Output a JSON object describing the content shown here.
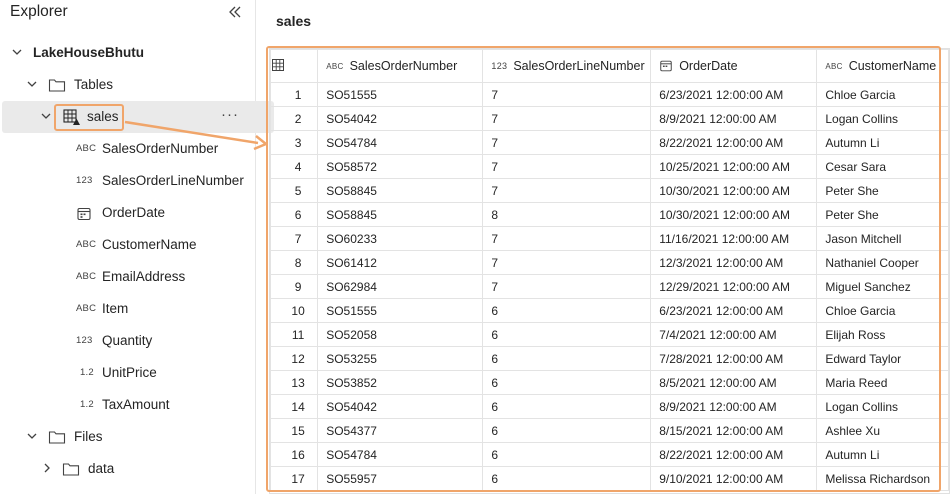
{
  "explorer": {
    "title": "Explorer",
    "lakehouse": "LakeHouseBhutu",
    "tables_folder": "Tables",
    "table_name": "sales",
    "more_label": "···",
    "columns": [
      {
        "type": "ABC",
        "name": "SalesOrderNumber"
      },
      {
        "type": "123",
        "name": "SalesOrderLineNumber"
      },
      {
        "type": "calendar",
        "name": "OrderDate"
      },
      {
        "type": "ABC",
        "name": "CustomerName"
      },
      {
        "type": "ABC",
        "name": "EmailAddress"
      },
      {
        "type": "ABC",
        "name": "Item"
      },
      {
        "type": "123",
        "name": "Quantity"
      },
      {
        "type": "1.2",
        "name": "UnitPrice"
      },
      {
        "type": "1.2",
        "name": "TaxAmount"
      }
    ],
    "files_folder": "Files",
    "data_folder": "data"
  },
  "main": {
    "title": "sales",
    "headers": [
      {
        "type": "ABC",
        "label": "SalesOrderNumber"
      },
      {
        "type": "123",
        "label": "SalesOrderLineNumber"
      },
      {
        "type": "calendar",
        "label": "OrderDate"
      },
      {
        "type": "ABC",
        "label": "CustomerName"
      }
    ],
    "rows": [
      [
        "1",
        "SO51555",
        "7",
        "6/23/2021 12:00:00 AM",
        "Chloe Garcia"
      ],
      [
        "2",
        "SO54042",
        "7",
        "8/9/2021 12:00:00 AM",
        "Logan Collins"
      ],
      [
        "3",
        "SO54784",
        "7",
        "8/22/2021 12:00:00 AM",
        "Autumn Li"
      ],
      [
        "4",
        "SO58572",
        "7",
        "10/25/2021 12:00:00 AM",
        "Cesar Sara"
      ],
      [
        "5",
        "SO58845",
        "7",
        "10/30/2021 12:00:00 AM",
        "Peter She"
      ],
      [
        "6",
        "SO58845",
        "8",
        "10/30/2021 12:00:00 AM",
        "Peter She"
      ],
      [
        "7",
        "SO60233",
        "7",
        "11/16/2021 12:00:00 AM",
        "Jason Mitchell"
      ],
      [
        "8",
        "SO61412",
        "7",
        "12/3/2021 12:00:00 AM",
        "Nathaniel Cooper"
      ],
      [
        "9",
        "SO62984",
        "7",
        "12/29/2021 12:00:00 AM",
        "Miguel Sanchez"
      ],
      [
        "10",
        "SO51555",
        "6",
        "6/23/2021 12:00:00 AM",
        "Chloe Garcia"
      ],
      [
        "11",
        "SO52058",
        "6",
        "7/4/2021 12:00:00 AM",
        "Elijah Ross"
      ],
      [
        "12",
        "SO53255",
        "6",
        "7/28/2021 12:00:00 AM",
        "Edward Taylor"
      ],
      [
        "13",
        "SO53852",
        "6",
        "8/5/2021 12:00:00 AM",
        "Maria Reed"
      ],
      [
        "14",
        "SO54042",
        "6",
        "8/9/2021 12:00:00 AM",
        "Logan Collins"
      ],
      [
        "15",
        "SO54377",
        "6",
        "8/15/2021 12:00:00 AM",
        "Ashlee Xu"
      ],
      [
        "16",
        "SO54784",
        "6",
        "8/22/2021 12:00:00 AM",
        "Autumn Li"
      ],
      [
        "17",
        "SO55957",
        "6",
        "9/10/2021 12:00:00 AM",
        "Melissa Richardson"
      ]
    ]
  },
  "colors": {
    "highlight": "#f0a56a",
    "selected_row": "#eaeaea"
  }
}
